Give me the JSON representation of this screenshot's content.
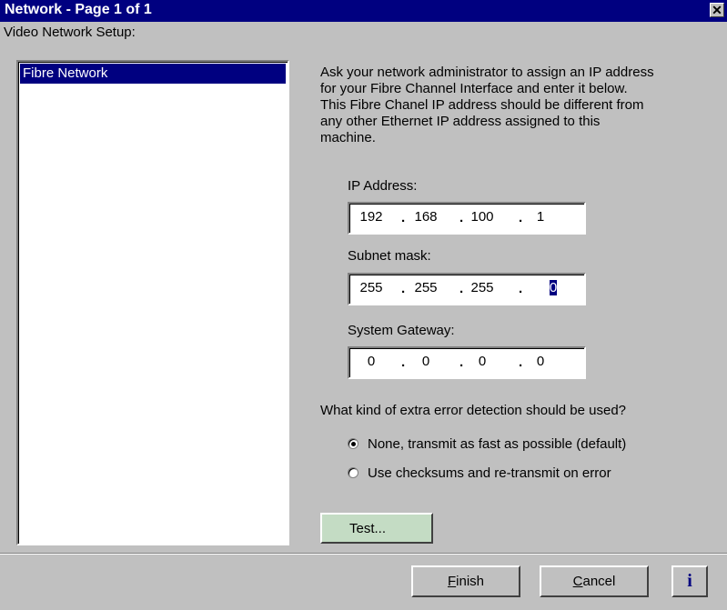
{
  "window": {
    "title": "Network - Page 1 of 1",
    "close_glyph": "✕"
  },
  "sidebar": {
    "label": "Video Network Setup:",
    "items": [
      {
        "label": "Fibre Network",
        "selected": true
      }
    ]
  },
  "description": [
    "Ask your network administrator to assign an IP address",
    "for your Fibre Channel Interface and enter it below.",
    "This Fibre Chanel IP address should be different from",
    "any other Ethernet IP address assigned to this",
    "machine."
  ],
  "fields": {
    "ip": {
      "label": "IP Address:",
      "octets": [
        "192",
        "168",
        "100",
        "1"
      ]
    },
    "subnet": {
      "label": "Subnet mask:",
      "octets": [
        "255",
        "255",
        "255",
        "0"
      ]
    },
    "gateway": {
      "label": "System Gateway:",
      "octets": [
        "0",
        "0",
        "0",
        "0"
      ]
    }
  },
  "error_detection": {
    "question": "What kind of extra error detection should be used?",
    "options": [
      {
        "label": "None, transmit as fast as possible (default)",
        "checked": true
      },
      {
        "label": "Use checksums and re-transmit on error",
        "checked": false
      }
    ]
  },
  "buttons": {
    "test": "Test...",
    "finish_accel": "F",
    "finish_rest": "inish",
    "cancel_accel": "C",
    "cancel_rest": "ancel",
    "info": "i"
  },
  "colors": {
    "title_bar": "#000080",
    "dialog_bg": "#c0c0c0",
    "test_button_bg": "#c4dcc4"
  }
}
